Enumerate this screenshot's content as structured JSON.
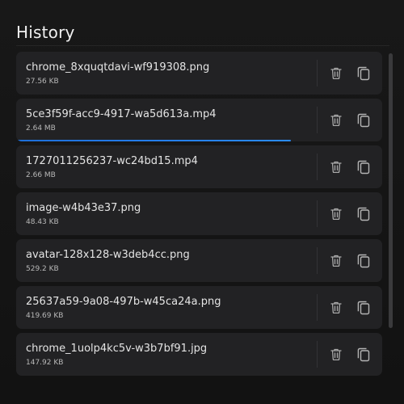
{
  "header": {
    "title": "History"
  },
  "history": [
    {
      "name": "chrome_8xquqtdavi-wf919308.png",
      "size": "27.56 KB",
      "progress": null
    },
    {
      "name": "5ce3f59f-acc9-4917-wa5d613a.mp4",
      "size": "2.64 MB",
      "progress": 0.75
    },
    {
      "name": "1727011256237-wc24bd15.mp4",
      "size": "2.66 MB",
      "progress": null
    },
    {
      "name": "image-w4b43e37.png",
      "size": "48.43 KB",
      "progress": null
    },
    {
      "name": "avatar-128x128-w3deb4cc.png",
      "size": "529.2 KB",
      "progress": null
    },
    {
      "name": "25637a59-9a08-497b-w45ca24a.png",
      "size": "419.69 KB",
      "progress": null
    },
    {
      "name": "chrome_1uolp4kc5v-w3b7bf91.jpg",
      "size": "147.92 KB",
      "progress": null
    }
  ],
  "icons": {
    "delete": "trash-icon",
    "copy": "copy-icon"
  },
  "colors": {
    "accent": "#2b8cff",
    "background": "#141414",
    "card": "#222224"
  }
}
